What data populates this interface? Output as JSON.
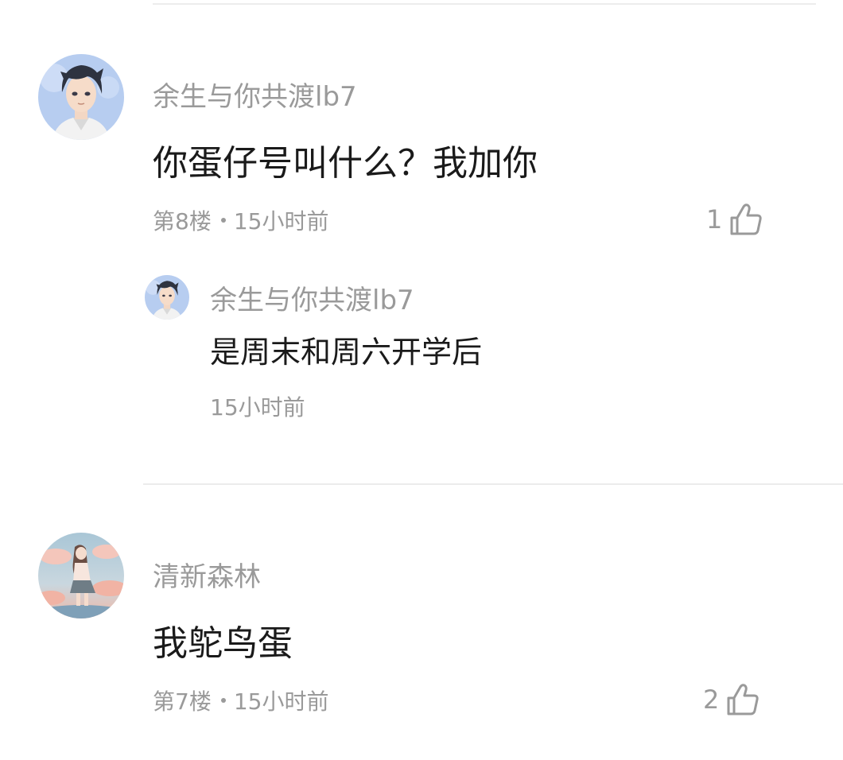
{
  "comments": [
    {
      "username": "余生与你共渡lb7",
      "text": "你蛋仔号叫什么？我加你",
      "floor": "第8楼",
      "time": "15小时前",
      "likes": "1",
      "reply": {
        "username": "余生与你共渡lb7",
        "text": "是周末和周六开学后",
        "time": "15小时前"
      }
    },
    {
      "username": "清新森林",
      "text": "我鸵鸟蛋",
      "floor": "第7楼",
      "time": "15小时前",
      "likes": "2"
    }
  ],
  "icons": {
    "like": "thumbs-up-icon"
  },
  "colors": {
    "primary_text": "#1a1a1a",
    "secondary_text": "#9a9a9a",
    "divider": "#ececec"
  }
}
